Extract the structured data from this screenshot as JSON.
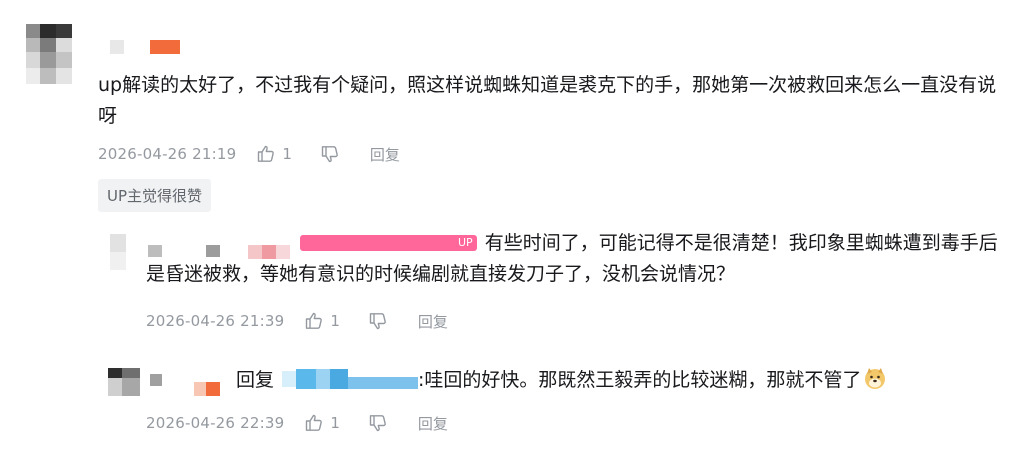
{
  "comments": [
    {
      "text": "up解读的太好了，不过我有个疑问，照这样说蜘蛛知道是裘克下的手，那她第一次被救回来怎么一直没有说呀",
      "time": "2026-04-26 21:19",
      "likes": "1",
      "reply_label": "回复",
      "badge": "UP主觉得很赞"
    }
  ],
  "replies": [
    {
      "up_tag": "UP",
      "text": "有些时间了，可能记得不是很清楚！我印象里蜘蛛遭到毒手后是昏迷被救，等她有意识的时候编剧就直接发刀子了，没机会说情况？",
      "time": "2026-04-26 21:39",
      "likes": "1",
      "reply_label": "回复"
    },
    {
      "reply_prefix": "回复",
      "text": ":哇回的好快。那既然王毅弄的比较迷糊，那就不管了",
      "emoji": "doge-emoji",
      "time": "2026-04-26 22:39",
      "likes": "1",
      "reply_label": "回复"
    }
  ],
  "icons": {
    "like": "thumbs-up-icon",
    "dislike": "thumbs-down-icon"
  },
  "colors": {
    "up_tag": "#ff6699",
    "meta_text": "#9499a0",
    "badge_bg": "#f1f2f3",
    "username_blur_orange": "#f26b3a",
    "username_blur_blue": "#5bb8ea"
  }
}
